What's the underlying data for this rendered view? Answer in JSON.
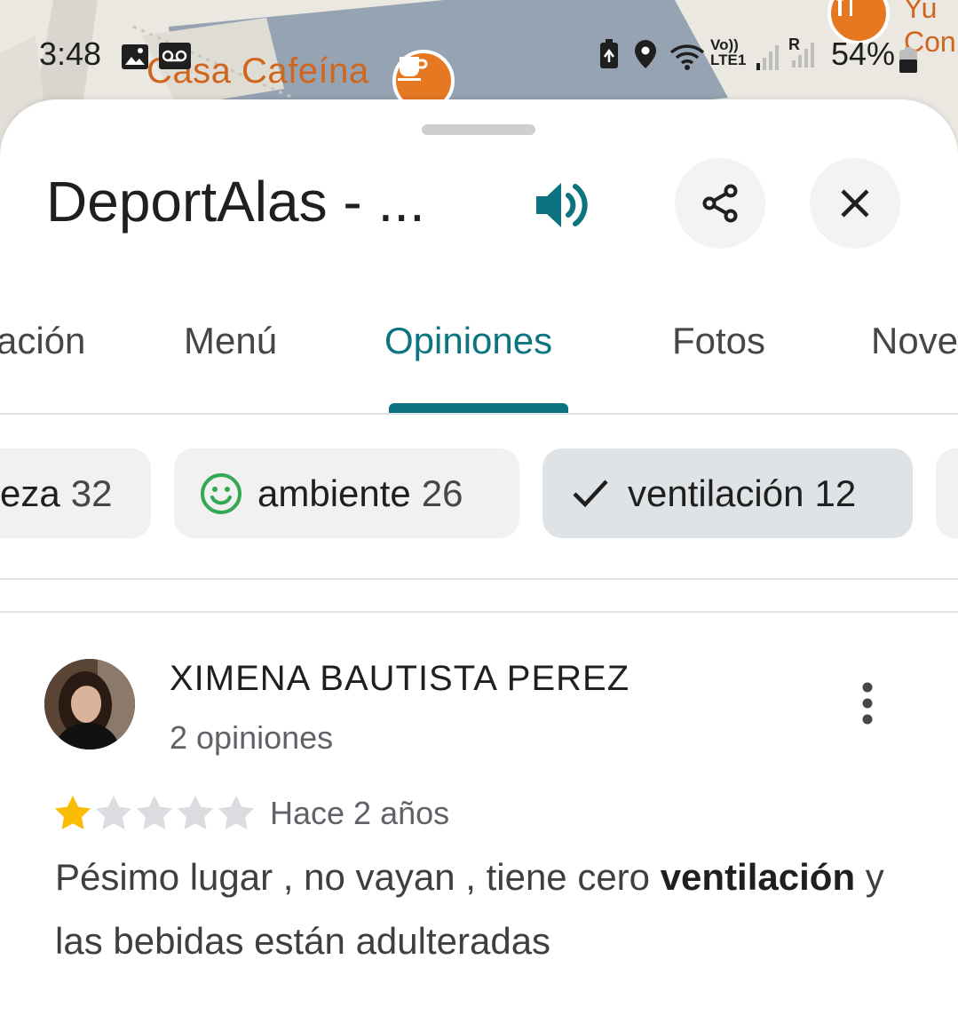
{
  "status_bar": {
    "time": "3:48",
    "battery_percent": "54%",
    "icons": [
      "gallery-icon",
      "voicemail-icon",
      "battery-saver-icon",
      "location-icon",
      "wifi-icon",
      "volte-icon",
      "signal-icon",
      "roaming-signal-icon",
      "battery-icon"
    ],
    "volte_label": "Vo)) LTE1",
    "roaming_label": "R"
  },
  "map": {
    "place_label": "Casa Cafeína",
    "other_label_1": "Yu",
    "other_label_2": "Con"
  },
  "place": {
    "title": "DeportAlas - ..."
  },
  "tabs": [
    {
      "label": "ación",
      "active": false
    },
    {
      "label": "Menú",
      "active": false
    },
    {
      "label": "Opiniones",
      "active": true
    },
    {
      "label": "Fotos",
      "active": false
    },
    {
      "label": "Nove",
      "active": false
    }
  ],
  "chips": [
    {
      "label": "eza",
      "count": "32",
      "selected": false
    },
    {
      "label": "ambiente",
      "count": "26",
      "icon": "smile-icon",
      "selected": false
    },
    {
      "label": "ventilación",
      "count": "12",
      "icon": "check-icon",
      "selected": true
    }
  ],
  "review": {
    "reviewer_name": "XIMENA BAUTISTA PEREZ",
    "reviewer_count": "2 opiniones",
    "rating": 1,
    "rating_max": 5,
    "time_ago": "Hace 2 años",
    "text_before": "Pésimo lugar , no vayan , tiene cero ",
    "text_highlight": "ventilación",
    "text_after": " y las bebidas están adulteradas"
  },
  "colors": {
    "accent": "#0b7480",
    "star_filled": "#fbbc04",
    "star_empty": "#dadce0",
    "chip_smile": "#34a853",
    "map_pin": "#e67822"
  }
}
